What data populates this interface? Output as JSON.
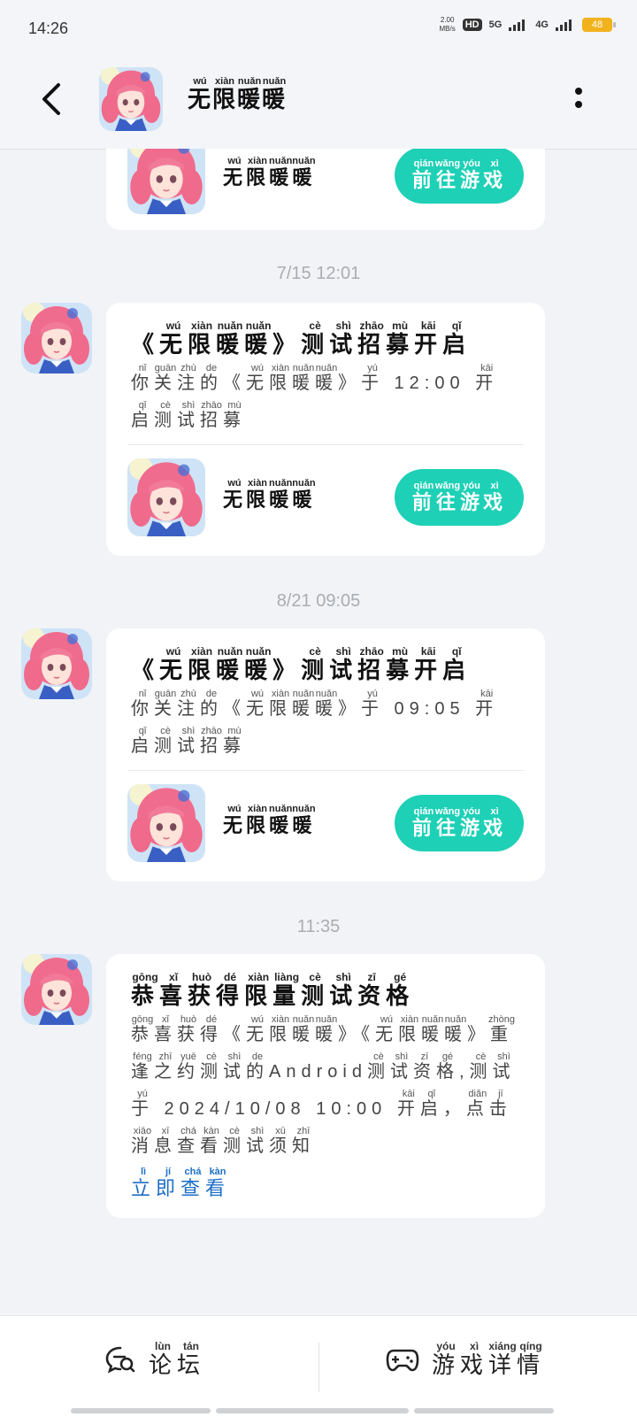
{
  "status_bar": {
    "time": "14:26",
    "speed_value": "2.00",
    "speed_unit": "MB/s",
    "hd": "HD",
    "net1": "5G",
    "net2": "4G",
    "battery": "48"
  },
  "header": {
    "title": [
      {
        "c": "无",
        "p": "wú"
      },
      {
        "c": "限",
        "p": "xiàn"
      },
      {
        "c": "暖",
        "p": "nuǎn"
      },
      {
        "c": "暖",
        "p": "nuǎn"
      }
    ]
  },
  "game_name": [
    {
      "c": "无",
      "p": "wú"
    },
    {
      "c": "限",
      "p": "xiàn"
    },
    {
      "c": "暖",
      "p": "nuǎn"
    },
    {
      "c": "暖",
      "p": "nuǎn"
    }
  ],
  "go_button": [
    {
      "c": "前",
      "p": "qián"
    },
    {
      "c": "往",
      "p": "wǎng"
    },
    {
      "c": "游",
      "p": "yóu"
    },
    {
      "c": "戏",
      "p": "xì"
    }
  ],
  "messages": [
    {
      "timestamp": "7/15  12:01",
      "title": [
        {
          "c": "《",
          "p": ""
        },
        {
          "c": "无",
          "p": "wú"
        },
        {
          "c": "限",
          "p": "xiàn"
        },
        {
          "c": "暖",
          "p": "nuǎn"
        },
        {
          "c": "暖",
          "p": "nuǎn"
        },
        {
          "c": "》",
          "p": ""
        },
        {
          "c": "测",
          "p": "cè"
        },
        {
          "c": "试",
          "p": "shì"
        },
        {
          "c": "招",
          "p": "zhāo"
        },
        {
          "c": "募",
          "p": "mù"
        },
        {
          "c": "开",
          "p": "kāi"
        },
        {
          "c": "启",
          "p": "qǐ"
        }
      ],
      "body": [
        {
          "c": "你",
          "p": "nǐ"
        },
        {
          "c": "关",
          "p": "guān"
        },
        {
          "c": "注",
          "p": "zhù"
        },
        {
          "c": "的",
          "p": "de"
        },
        {
          "c": "《",
          "p": ""
        },
        {
          "c": "无",
          "p": "wú"
        },
        {
          "c": "限",
          "p": "xiàn"
        },
        {
          "c": "暖",
          "p": "nuǎn"
        },
        {
          "c": "暖",
          "p": "nuǎn"
        },
        {
          "c": "》",
          "p": ""
        },
        {
          "c": "于",
          "p": "yú"
        },
        {
          "c": " 12:00 ",
          "p": ""
        },
        {
          "c": "开",
          "p": "kāi"
        },
        {
          "c": "启",
          "p": "qǐ"
        },
        {
          "c": "测",
          "p": "cè"
        },
        {
          "c": "试",
          "p": "shì"
        },
        {
          "c": "招",
          "p": "zhāo"
        },
        {
          "c": "募",
          "p": "mù"
        }
      ]
    },
    {
      "timestamp": "8/21  09:05",
      "title": [
        {
          "c": "《",
          "p": ""
        },
        {
          "c": "无",
          "p": "wú"
        },
        {
          "c": "限",
          "p": "xiàn"
        },
        {
          "c": "暖",
          "p": "nuǎn"
        },
        {
          "c": "暖",
          "p": "nuǎn"
        },
        {
          "c": "》",
          "p": ""
        },
        {
          "c": "测",
          "p": "cè"
        },
        {
          "c": "试",
          "p": "shì"
        },
        {
          "c": "招",
          "p": "zhāo"
        },
        {
          "c": "募",
          "p": "mù"
        },
        {
          "c": "开",
          "p": "kāi"
        },
        {
          "c": "启",
          "p": "qǐ"
        }
      ],
      "body": [
        {
          "c": "你",
          "p": "nǐ"
        },
        {
          "c": "关",
          "p": "guān"
        },
        {
          "c": "注",
          "p": "zhù"
        },
        {
          "c": "的",
          "p": "de"
        },
        {
          "c": "《",
          "p": ""
        },
        {
          "c": "无",
          "p": "wú"
        },
        {
          "c": "限",
          "p": "xiàn"
        },
        {
          "c": "暖",
          "p": "nuǎn"
        },
        {
          "c": "暖",
          "p": "nuǎn"
        },
        {
          "c": "》",
          "p": ""
        },
        {
          "c": "于",
          "p": "yú"
        },
        {
          "c": " 09:05 ",
          "p": ""
        },
        {
          "c": "开",
          "p": "kāi"
        },
        {
          "c": "启",
          "p": "qǐ"
        },
        {
          "c": "测",
          "p": "cè"
        },
        {
          "c": "试",
          "p": "shì"
        },
        {
          "c": "招",
          "p": "zhāo"
        },
        {
          "c": "募",
          "p": "mù"
        }
      ]
    },
    {
      "timestamp": "11:35",
      "title": [
        {
          "c": "恭",
          "p": "gōng"
        },
        {
          "c": "喜",
          "p": "xǐ"
        },
        {
          "c": "获",
          "p": "huò"
        },
        {
          "c": "得",
          "p": "dé"
        },
        {
          "c": "限",
          "p": "xiàn"
        },
        {
          "c": "量",
          "p": "liàng"
        },
        {
          "c": "测",
          "p": "cè"
        },
        {
          "c": "试",
          "p": "shì"
        },
        {
          "c": "资",
          "p": "zī"
        },
        {
          "c": "格",
          "p": "gé"
        }
      ],
      "body": [
        {
          "c": "恭",
          "p": "gōng"
        },
        {
          "c": "喜",
          "p": "xǐ"
        },
        {
          "c": "获",
          "p": "huò"
        },
        {
          "c": "得",
          "p": "dé"
        },
        {
          "c": "《",
          "p": ""
        },
        {
          "c": "无",
          "p": "wú"
        },
        {
          "c": "限",
          "p": "xiàn"
        },
        {
          "c": "暖",
          "p": "nuǎn"
        },
        {
          "c": "暖",
          "p": "nuǎn"
        },
        {
          "c": "》",
          "p": ""
        },
        {
          "c": "《",
          "p": ""
        },
        {
          "c": "无",
          "p": "wú"
        },
        {
          "c": "限",
          "p": "xiàn"
        },
        {
          "c": "暖",
          "p": "nuǎn"
        },
        {
          "c": "暖",
          "p": "nuǎn"
        },
        {
          "c": "》",
          "p": ""
        },
        {
          "c": "重",
          "p": "zhòng"
        },
        {
          "c": "逢",
          "p": "féng"
        },
        {
          "c": "之",
          "p": "zhī"
        },
        {
          "c": "约",
          "p": "yuē"
        },
        {
          "c": "测",
          "p": "cè"
        },
        {
          "c": "试",
          "p": "shì"
        },
        {
          "c": "的",
          "p": "de"
        },
        {
          "c": "Android",
          "p": ""
        },
        {
          "c": "测",
          "p": "cè"
        },
        {
          "c": "试",
          "p": "shì"
        },
        {
          "c": "资",
          "p": "zī"
        },
        {
          "c": "格",
          "p": "gé"
        },
        {
          "c": ",",
          "p": ""
        },
        {
          "c": "测",
          "p": "cè"
        },
        {
          "c": "试",
          "p": "shì"
        },
        {
          "c": "于",
          "p": "yú"
        },
        {
          "c": " 2024/10/08 10:00 ",
          "p": ""
        },
        {
          "c": "开",
          "p": "kāi"
        },
        {
          "c": "启",
          "p": "qǐ"
        },
        {
          "c": "，",
          "p": ""
        },
        {
          "c": "点",
          "p": "diǎn"
        },
        {
          "c": "击",
          "p": "jī"
        },
        {
          "c": "消",
          "p": "xiāo"
        },
        {
          "c": "息",
          "p": "xī"
        },
        {
          "c": "查",
          "p": "chá"
        },
        {
          "c": "看",
          "p": "kàn"
        },
        {
          "c": "测",
          "p": "cè"
        },
        {
          "c": "试",
          "p": "shì"
        },
        {
          "c": "须",
          "p": "xū"
        },
        {
          "c": "知",
          "p": "zhī"
        }
      ],
      "link": [
        {
          "c": "立",
          "p": "lì"
        },
        {
          "c": "即",
          "p": "jí"
        },
        {
          "c": "查",
          "p": "chá"
        },
        {
          "c": "看",
          "p": "kàn"
        }
      ]
    }
  ],
  "bottom_nav": {
    "forum": [
      {
        "c": "论",
        "p": "lùn"
      },
      {
        "c": "坛",
        "p": "tán"
      }
    ],
    "game_detail": [
      {
        "c": "游",
        "p": "yóu"
      },
      {
        "c": "戏",
        "p": "xì"
      },
      {
        "c": "详",
        "p": "xiáng"
      },
      {
        "c": "情",
        "p": "qíng"
      }
    ]
  },
  "colors": {
    "accent": "#1ed0b6",
    "link": "#1d6fc7",
    "background": "#f1f3f6",
    "battery": "#f2b21e"
  },
  "icons": {
    "back": "chevron-left-icon",
    "more": "more-vertical-icon",
    "forum": "chat-search-icon",
    "game_detail": "gamepad-icon"
  }
}
